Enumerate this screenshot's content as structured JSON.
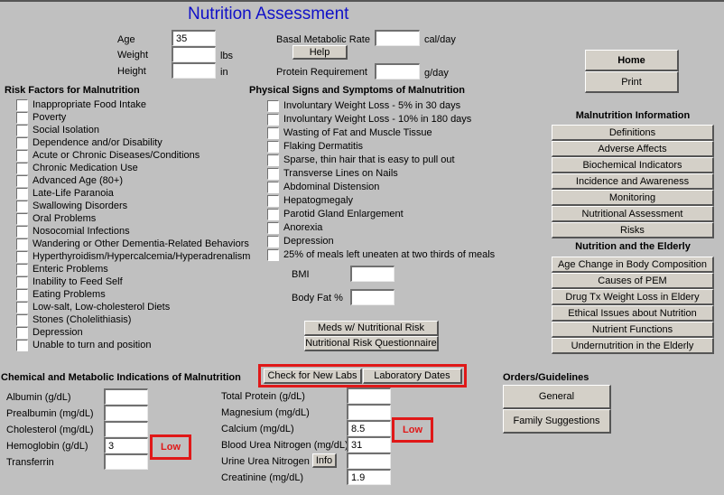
{
  "title": "Nutrition Assessment",
  "vitals": {
    "age_label": "Age",
    "age_value": "35",
    "weight_label": "Weight",
    "weight_value": "",
    "weight_unit": "lbs",
    "height_label": "Height",
    "height_value": "",
    "height_unit": "in",
    "bmr_label": "Basal Metabolic Rate",
    "bmr_value": "",
    "bmr_unit": "cal/day",
    "help_label": "Help",
    "protein_label": "Protein Requirement",
    "protein_value": "",
    "protein_unit": "g/day"
  },
  "nav": {
    "home_label": "Home",
    "print_label": "Print"
  },
  "risk_factors": {
    "heading": "Risk Factors for Malnutrition",
    "items": [
      "Inappropriate Food Intake",
      "Poverty",
      "Social Isolation",
      "Dependence and/or Disability",
      "Acute or Chronic Diseases/Conditions",
      "Chronic Medication Use",
      "Advanced Age (80+)",
      "Late-Life Paranoia",
      "Swallowing Disorders",
      "Oral Problems",
      "Nosocomial Infections",
      "Wandering or Other Dementia-Related Behaviors",
      "Hyperthyroidism/Hypercalcemia/Hyperadrenalism",
      "Enteric Problems",
      "Inability to Feed Self",
      "Eating Problems",
      "Low-salt, Low-cholesterol Diets",
      "Stones (Cholelithiasis)",
      "Depression",
      "Unable to turn and position"
    ]
  },
  "physical_signs": {
    "heading": "Physical Signs and Symptoms of Malnutrition",
    "items": [
      "Involuntary Weight Loss - 5% in 30 days",
      "Involuntary Weight Loss - 10% in 180 days",
      "Wasting of Fat and Muscle Tissue",
      "Flaking Dermatitis",
      "Sparse, thin hair that is easy to pull out",
      "Transverse Lines on Nails",
      "Abdominal Distension",
      "Hepatogmegaly",
      "Parotid Gland Enlargement",
      "Anorexia",
      "Depression",
      "25% of meals left uneaten at two thirds of meals"
    ],
    "bmi_label": "BMI",
    "bmi_value": "",
    "bodyfat_label": "Body Fat %",
    "bodyfat_value": "",
    "meds_button": "Meds w/ Nutritional Risk",
    "questionnaire_button": "Nutritional Risk Questionnaire"
  },
  "malnutrition_info": {
    "heading": "Malnutrition Information",
    "items": [
      "Definitions",
      "Adverse Affects",
      "Biochemical Indicators",
      "Incidence and Awareness",
      "Monitoring",
      "Nutritional Assessment",
      "Risks"
    ]
  },
  "elderly": {
    "heading": "Nutrition and the Elderly",
    "items": [
      "Age Change in Body Composition",
      "Causes of PEM",
      "Drug Tx Weight Loss in Eldery",
      "Ethical Issues about Nutrition",
      "Nutrient Functions",
      "Undernutrition in the Elderly"
    ]
  },
  "chemical": {
    "heading": "Chemical and Metabolic Indications of Malnutrition",
    "check_labs_button": "Check for New Labs",
    "lab_dates_button": "Laboratory Dates",
    "left": [
      {
        "label": "Albumin (g/dL)",
        "value": ""
      },
      {
        "label": "Prealbumin (mg/dL)",
        "value": ""
      },
      {
        "label": "Cholesterol (mg/dL)",
        "value": ""
      },
      {
        "label": "Hemoglobin (g/dL)",
        "value": "3",
        "flag": "Low"
      },
      {
        "label": "Transferrin",
        "value": ""
      }
    ],
    "right": [
      {
        "label": "Total Protein (g/dL)",
        "value": ""
      },
      {
        "label": "Magnesium (mg/dL)",
        "value": ""
      },
      {
        "label": "Calcium (mg/dL)",
        "value": "8.5",
        "flag": "Low"
      },
      {
        "label": "Blood Urea Nitrogen (mg/dL)",
        "value": "31"
      },
      {
        "label": "Urine Urea Nitrogen",
        "value": "",
        "info_button": "Info"
      },
      {
        "label": "Creatinine (mg/dL)",
        "value": "1.9"
      }
    ]
  },
  "orders": {
    "heading": "Orders/Guidelines",
    "general_button": "General",
    "family_button": "Family Suggestions"
  },
  "colors": {
    "background": "#c0c0c0",
    "title": "#1010c8",
    "alert": "#e01818",
    "button": "#d4d0c8"
  }
}
